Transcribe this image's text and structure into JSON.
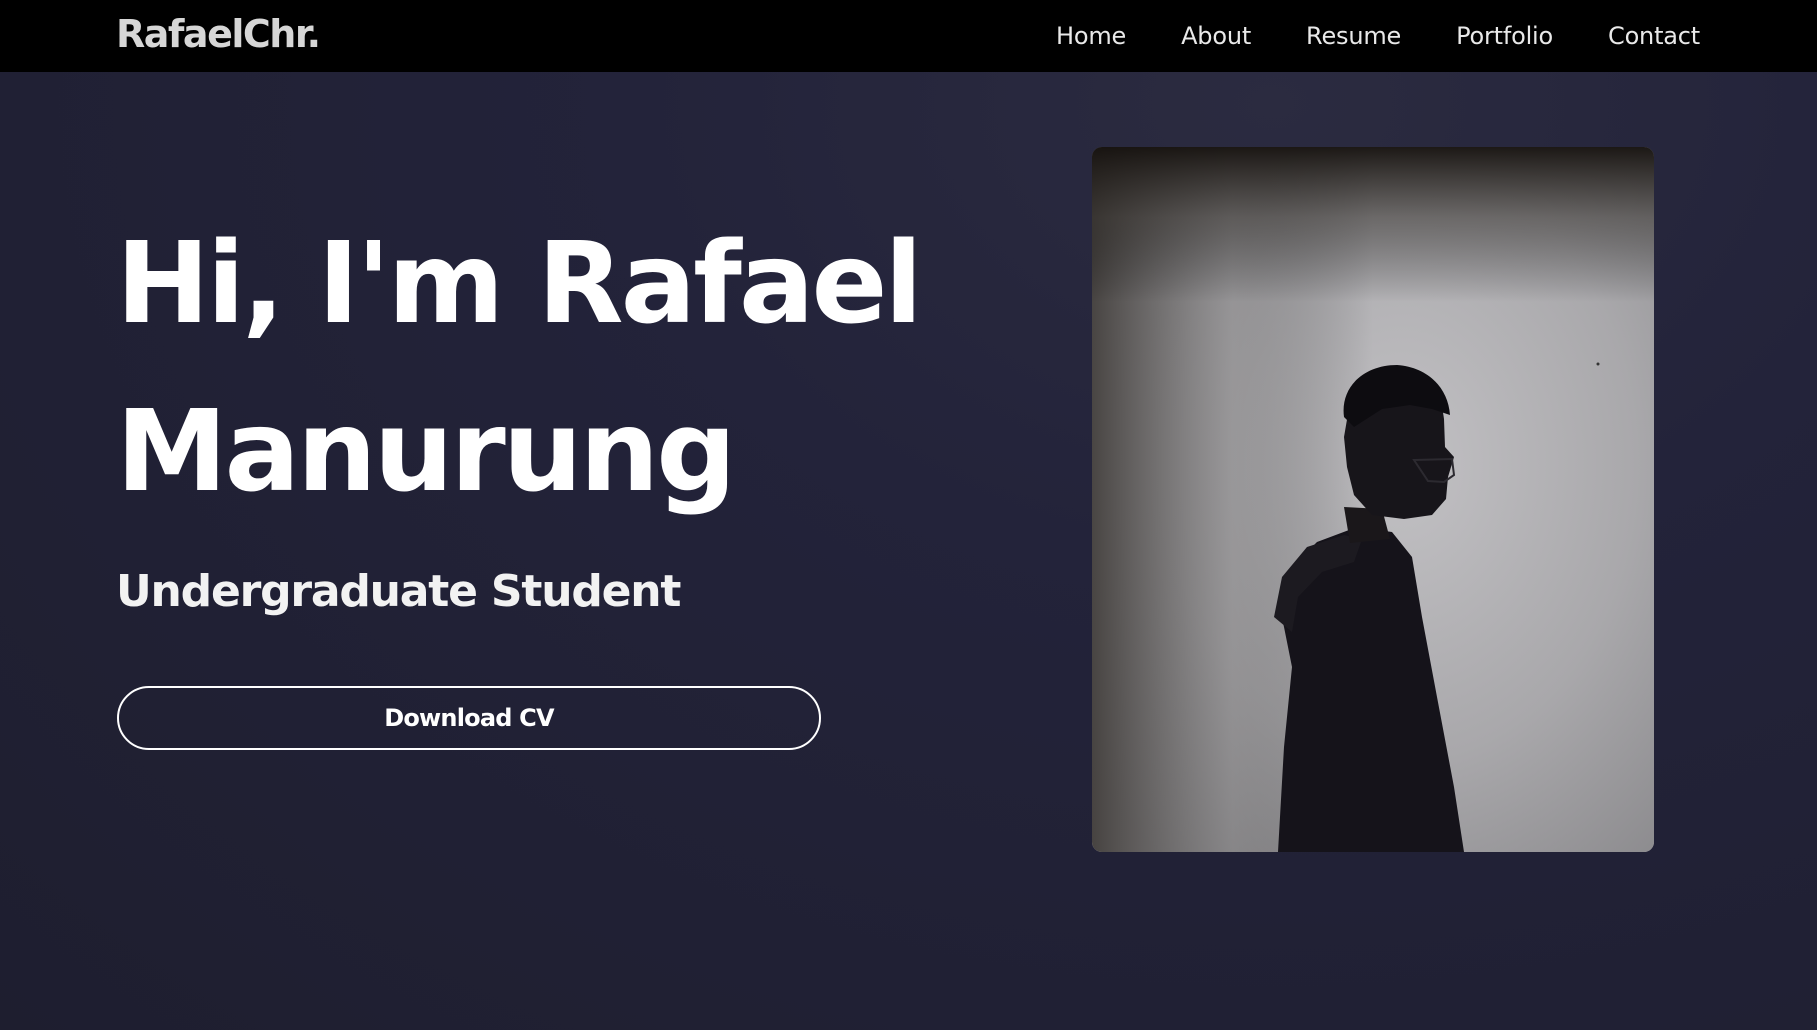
{
  "navbar": {
    "logo": "RafaelChr.",
    "items": [
      {
        "label": "Home"
      },
      {
        "label": "About"
      },
      {
        "label": "Resume"
      },
      {
        "label": "Portfolio"
      },
      {
        "label": "Contact"
      }
    ]
  },
  "hero": {
    "title_line1": "Hi, I'm Rafael",
    "title_line2": "Manurung",
    "subtitle": "Undergraduate Student",
    "cta_label": "Download CV"
  },
  "colors": {
    "background": "#23233a",
    "navbar": "#000000",
    "text": "#ffffff"
  }
}
